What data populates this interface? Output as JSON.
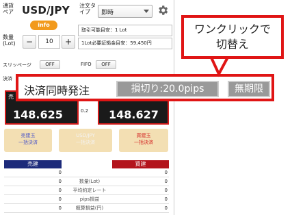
{
  "header": {
    "pair_label": "通貨ペア",
    "pair": "USD/JPY",
    "order_type_label": "注文タイプ",
    "order_type_value": "即時",
    "settings_icon": "gear-icon",
    "info_label": "info"
  },
  "quantity": {
    "label": "数量(Lot)",
    "minus": "−",
    "value": "10",
    "plus": "+",
    "tradable_estimate": "取引可能目安：1 Lot",
    "margin_estimate": "1Lot必要証拠金目安：59,450円"
  },
  "toggles": {
    "slippage_label": "スリッページ",
    "slippage_value": "OFF",
    "fifo_label": "FIFO",
    "fifo_value": "OFF",
    "settle_label_partial": "決済"
  },
  "prices": {
    "sell_label": "売",
    "sell_price": "148.625",
    "spread": "0.2",
    "buy_price": "148.627"
  },
  "bulk": {
    "sell_title": "売建玉",
    "sell_sub": "一括決済",
    "all_title": "USD/JPY",
    "all_sub": "一括決済",
    "buy_title": "買建玉",
    "buy_sub": "一括決済"
  },
  "table": {
    "sell_header": "売建",
    "buy_header": "買建",
    "rows": [
      {
        "sell": "0",
        "label": "",
        "buy": "0"
      },
      {
        "sell": "0",
        "label": "数量(Lot)",
        "buy": "0"
      },
      {
        "sell": "0",
        "label": "平均約定レート",
        "buy": "0"
      },
      {
        "sell": "0",
        "label": "pips損益",
        "buy": "0"
      },
      {
        "sell": "0",
        "label": "概算損益(円)",
        "buy": "0"
      }
    ]
  },
  "callout": {
    "title": "決済同時発注",
    "stop_loss": "損切り:20.0pips",
    "unlimited": "無期限"
  },
  "bubble": {
    "line1": "ワンクリックで",
    "line2": "切替え"
  },
  "colors": {
    "accent_red": "#e01515",
    "info_orange": "#f29a1d",
    "sell_blue": "#1c2a7a",
    "buy_red": "#b3141c"
  }
}
